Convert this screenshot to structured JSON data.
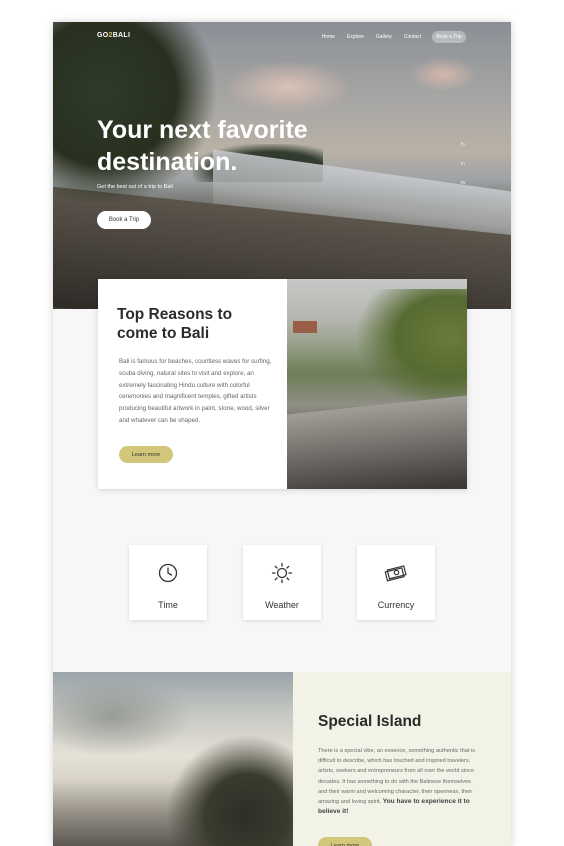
{
  "nav": {
    "logo_prefix": "GO",
    "logo_two": "2",
    "logo_suffix": "BALI",
    "links": [
      "Home",
      "Explore",
      "Gallery",
      "Contact"
    ],
    "cta_label": "Book a Trip"
  },
  "hero": {
    "title": "Your next favorite destination.",
    "subtitle": "Get the best out of a trip to Bali",
    "button_label": "Book a Trip",
    "social": [
      "fb",
      "in",
      "tw"
    ]
  },
  "reasons": {
    "title": "Top Reasons to come to Bali",
    "text": "Bali is famous for beaches, countless waves for surfing, scuba diving, natural sites to visit and explore, an extremely fascinating Hindu culture with colorful ceremonies and magnificent temples, gifted artists producing beautiful artwork in paint, stone, wood, silver and whatever can be shaped.",
    "button_label": "Learn more"
  },
  "features": [
    {
      "label": "Time",
      "icon": "clock-icon"
    },
    {
      "label": "Weather",
      "icon": "sun-icon"
    },
    {
      "label": "Currency",
      "icon": "money-icon"
    }
  ],
  "special": {
    "title": "Special Island",
    "text": "There is a special vibe, an essence, something authentic that is difficult to describe, which has touched and inspired travelers, artists, seekers and entrepreneurs from all over the world since decades. It has something to do with the Balinese themselves and their warm and welcoming character, their openness, their amazing and loving spirit.",
    "emphasis": "You have to experience it to believe it!",
    "button_label": "Learn more"
  },
  "colors": {
    "accent": "#d1c67a",
    "panel": "#f3f2e6"
  }
}
